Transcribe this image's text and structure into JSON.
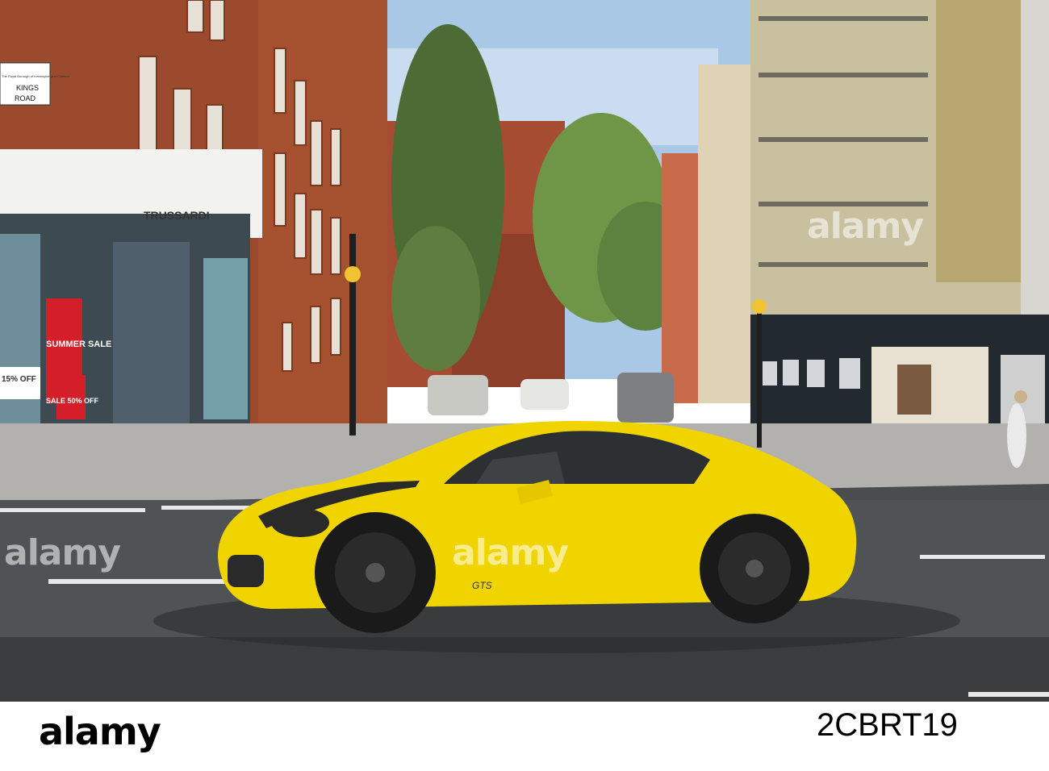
{
  "scene": {
    "street_sign": {
      "line1": "The Royal Borough of Kensington and Chelsea",
      "line2": "KINGS",
      "line3": "ROAD"
    },
    "store_sign": "TRUSSARDI",
    "window_posters": {
      "summer_sale": "SUMMER SALE",
      "discount_15": "15% OFF",
      "sale_50": "SALE 50% OFF"
    },
    "car_badge": "GTS",
    "colors": {
      "car": "#f0d400",
      "brick": "#9c4a2e",
      "sky": "#a9c8e6",
      "road": "#4a4d50"
    }
  },
  "watermark": {
    "text": "alamy"
  },
  "footer": {
    "logo": "alamy",
    "image_id": "2CBRT19"
  }
}
